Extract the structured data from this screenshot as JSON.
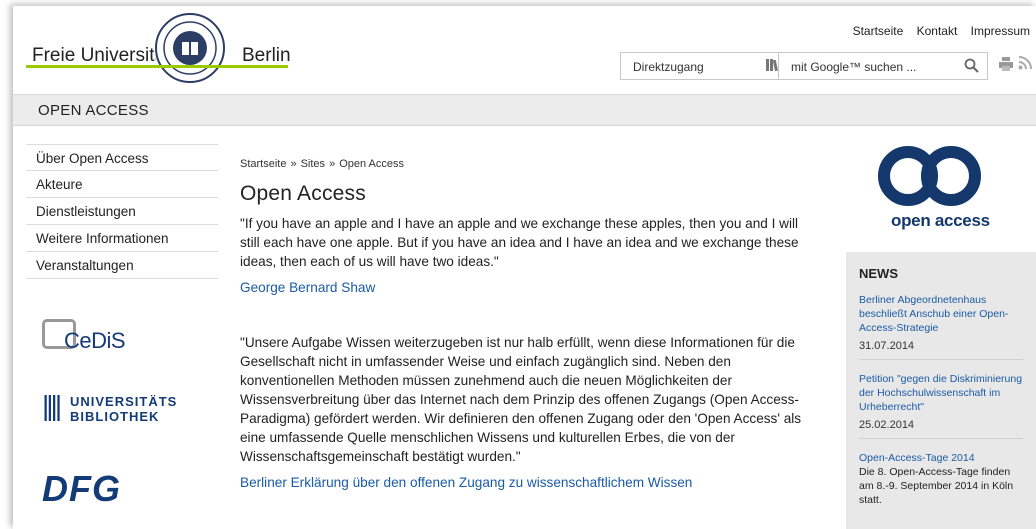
{
  "header": {
    "logo_word_left": "Freie Universität",
    "logo_word_right": "Berlin",
    "top_links": [
      "Startseite",
      "Kontakt",
      "Impressum"
    ],
    "direktzugang_label": "Direktzugang",
    "search_placeholder": "mit Google™ suchen ...",
    "icons": [
      "library-icon",
      "search-icon",
      "print-icon",
      "rss-icon"
    ]
  },
  "band": {
    "title": "OPEN ACCESS"
  },
  "nav": {
    "items": [
      "Über Open Access",
      "Akteure",
      "Dienstleistungen",
      "Weitere Informationen",
      "Veranstaltungen"
    ]
  },
  "logos": {
    "cedis": "CeDiS",
    "ub_line1": "UNIVERSITÄTS",
    "ub_line2": "BIBLIOTHEK",
    "dfg": "DFG"
  },
  "breadcrumb": [
    "Startseite",
    "Sites",
    "Open Access"
  ],
  "breadcrumb_sep": "»",
  "main": {
    "title": "Open Access",
    "quote1": "\"If you have an apple and I have an apple and we exchange these apples, then you and I will still each have one apple. But if you have an idea and I have an idea and we exchange these ideas, then each of us will have two ideas.\"",
    "author1": "George Bernard Shaw",
    "quote2": "\"Unsere Aufgabe Wissen weiterzugeben ist nur halb erfüllt, wenn diese Informationen für die Gesellschaft nicht in umfassender Weise und einfach zugänglich sind. Neben den konventionellen Methoden müssen zunehmend auch die neuen Möglichkeiten der Wissensverbreitung über das Internet nach dem Prinzip des offenen Zugangs (Open Access-Paradigma) gefördert werden. Wir definieren den offenen Zugang oder den 'Open Access' als eine umfassende Quelle menschlichen Wissens und kulturellen Erbes, die von der Wissenschaftsgemeinschaft bestätigt wurden.\"",
    "link2": "Berliner Erklärung über den offenen Zugang zu wissenschaftlichem Wissen"
  },
  "oa_logo": {
    "text": "open access",
    "color": "#14386b"
  },
  "news": {
    "heading": "NEWS",
    "entries": [
      {
        "title": "Berliner Abgeordnetenhaus beschließt Anschub einer Open-Access-Strategie",
        "date": "31.07.2014"
      },
      {
        "title": "Petition \"gegen die Diskriminierung der Hochschulwissenschaft im Urheberrecht\"",
        "date": "25.02.2014"
      },
      {
        "title": "Open-Access-Tage 2014",
        "desc": "Die 8. Open-Access-Tage finden am 8.-9. September 2014 in Köln statt."
      }
    ]
  },
  "colors": {
    "link": "#1a5ba6",
    "accent_green": "#99cc00",
    "brand_blue": "#123b78"
  }
}
